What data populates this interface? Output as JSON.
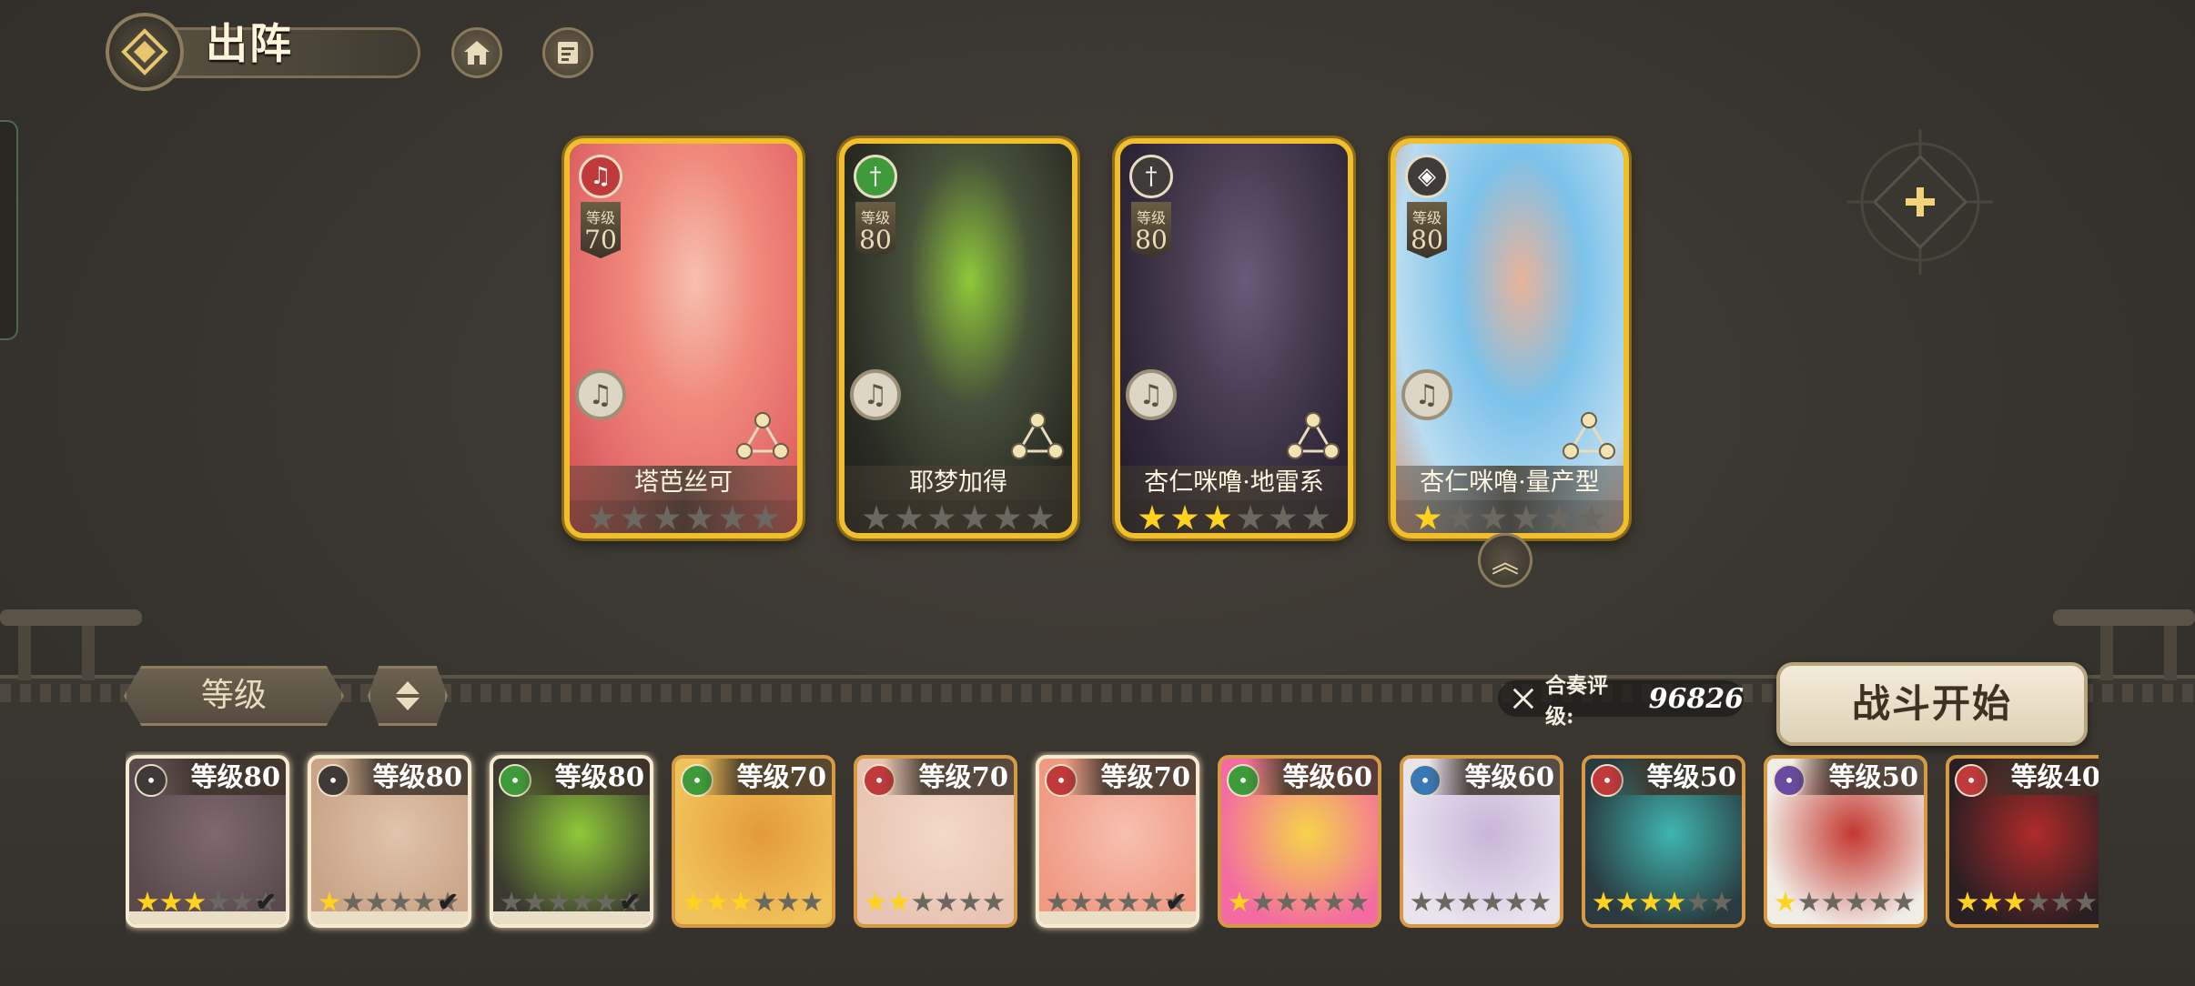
{
  "header": {
    "title": "出阵"
  },
  "colors": {
    "gold": "#f2bf2c",
    "star_on": "#ffd21f",
    "star_off": "#6b6860"
  },
  "icons": [
    "diamond-emblem-icon",
    "home-icon",
    "notes-icon",
    "plus-icon",
    "music-note-icon",
    "triangle-link-icon",
    "chevron-up-icon",
    "crossed-swords-icon"
  ],
  "team": [
    {
      "name": "塔芭丝可",
      "level_label": "等级",
      "level": "70",
      "stars": 0,
      "element": "lyre",
      "elem_color": "#c0393b",
      "art": [
        "#f08a7c",
        "#e36a6a",
        "#f6c0b0",
        "#c84c4c"
      ]
    },
    {
      "name": "耶梦加得",
      "level_label": "等级",
      "level": "80",
      "stars": 0,
      "element": "sword",
      "elem_color": "#3f9b3a",
      "art": [
        "#46503a",
        "#2b2d24",
        "#8fc93a",
        "#1c1e18"
      ]
    },
    {
      "name": "杏仁咪噜·地雷系",
      "level_label": "等级",
      "level": "80",
      "stars": 3,
      "element": "sword",
      "elem_color": "#3e3b39",
      "art": [
        "#4a3d52",
        "#2f2738",
        "#6a5a7a",
        "#1e1a24"
      ]
    },
    {
      "name": "杏仁咪噜·量产型",
      "level_label": "等级",
      "level": "80",
      "stars": 1,
      "element": "shield",
      "elem_color": "#3e3b39",
      "art": [
        "#7cc2ea",
        "#b9dcf0",
        "#e8b39a",
        "#d49276"
      ]
    }
  ],
  "sort": {
    "label": "等级"
  },
  "power": {
    "label": "合奏评级:",
    "value": "96826"
  },
  "start": {
    "label": "战斗开始"
  },
  "roster": [
    {
      "level": "等级80",
      "stars": 3,
      "selected": true,
      "color": "#3f3a37",
      "art": [
        "#5a4a4e",
        "#7d6a6e"
      ]
    },
    {
      "level": "等级80",
      "stars": 1,
      "selected": true,
      "color": "#3f3a37",
      "art": [
        "#c9a488",
        "#e0c4ac"
      ]
    },
    {
      "level": "等级80",
      "stars": 0,
      "selected": true,
      "color": "#3f9b3a",
      "art": [
        "#3a3a30",
        "#8fc93a"
      ]
    },
    {
      "level": "等级70",
      "stars": 3,
      "selected": false,
      "color": "#3f9b3a",
      "art": [
        "#f0c25a",
        "#e49a3a"
      ]
    },
    {
      "level": "等级70",
      "stars": 2,
      "selected": false,
      "color": "#c0393b",
      "art": [
        "#e8c4b4",
        "#f3d9c8"
      ]
    },
    {
      "level": "等级70",
      "stars": 0,
      "selected": true,
      "color": "#c0393b",
      "art": [
        "#f09a84",
        "#f6c0b0"
      ]
    },
    {
      "level": "等级60",
      "stars": 1,
      "selected": false,
      "color": "#3f9b3a",
      "art": [
        "#f36ba0",
        "#f5d44a"
      ]
    },
    {
      "level": "等级60",
      "stars": 0,
      "selected": false,
      "color": "#3a77b5",
      "art": [
        "#e9e3ee",
        "#c8b6d8"
      ]
    },
    {
      "level": "等级50",
      "stars": 4,
      "selected": false,
      "color": "#c0393b",
      "art": [
        "#2a3a3e",
        "#3fb6b0"
      ]
    },
    {
      "level": "等级50",
      "stars": 1,
      "selected": false,
      "color": "#6a4aa0",
      "art": [
        "#f0ece6",
        "#c4382f"
      ]
    },
    {
      "level": "等级40",
      "stars": 3,
      "selected": false,
      "color": "#c0393b",
      "art": [
        "#2a1f22",
        "#b02a2a"
      ]
    }
  ]
}
